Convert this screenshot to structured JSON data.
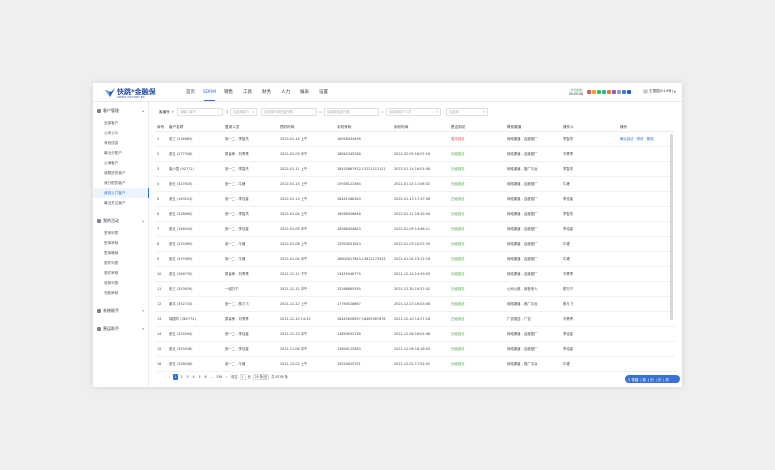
{
  "app": {
    "logo_text": "快跳*金融保",
    "logo_sub": "SDRM  VICTORY EX"
  },
  "nav": [
    {
      "label": "首页"
    },
    {
      "label": "SDRM"
    },
    {
      "label": "销售"
    },
    {
      "label": "工具"
    },
    {
      "label": "财务"
    },
    {
      "label": "人力"
    },
    {
      "label": "报表"
    },
    {
      "label": "设置"
    }
  ],
  "header": {
    "time_label": "今日在线",
    "time_value": "00:00:08",
    "user_name": "王振国(010号)"
  },
  "colors": {
    "accent": "#2a6fd6",
    "success": "#3aa23a",
    "danger": "#e04848"
  },
  "tools": [
    {
      "icon": "red-square-icon",
      "color": "#e35b4b"
    },
    {
      "icon": "orange-square-icon",
      "color": "#f0a030"
    },
    {
      "icon": "green-square-icon",
      "color": "#49b553"
    },
    {
      "icon": "teal-square-icon",
      "color": "#2fb7a6"
    },
    {
      "icon": "orange-square-icon",
      "color": "#f07a2a"
    },
    {
      "icon": "purple-square-icon",
      "color": "#8a5bd6"
    },
    {
      "icon": "grey-square-icon",
      "color": "#9aa3ad"
    },
    {
      "icon": "blue-square-icon",
      "color": "#3b7fe0"
    },
    {
      "icon": "blue-square-icon",
      "color": "#1f5fc8"
    }
  ],
  "sidebar": {
    "groups": [
      {
        "label": "客户管理",
        "icon": "users-icon",
        "items": [
          "全部客户",
          "公司公众",
          "有效信息",
          "最近分配户",
          "公海客户",
          "我跟进的客户",
          "我分配的客户",
          "我到上门客户",
          "最近关注客户"
        ]
      },
      {
        "label": "我的活动",
        "icon": "activity-icon",
        "items": [
          "签单列表",
          "签单审核",
          "签单撤销",
          "退件列表",
          "退件审核",
          "收款列表",
          "完款审核"
        ]
      },
      {
        "label": "系统助手",
        "icon": "helper-icon",
        "items": []
      },
      {
        "label": "营运助手",
        "icon": "ops-icon",
        "items": []
      }
    ],
    "active_item": "我到上门客户"
  },
  "filter": {
    "label": "客编号",
    "customer_placeholder": "请输入客户",
    "search_placeholder": "请选择部门",
    "time_from_placeholder": "请选择时间开始日期",
    "time_to_placeholder": "请选择结束日期",
    "dept_placeholder": "请选择部门人员",
    "status_placeholder": "请选择"
  },
  "table": {
    "headers": [
      "序号",
      "客户名称",
      "登录人员",
      "预约时间",
      "手机号码",
      "到访时间",
      "是否到访",
      "联系渠道",
      "操作人",
      "操作"
    ],
    "rows": [
      [
        "1",
        "张三 (234685)",
        "张一二 - 李智杰",
        "2022-01-14 上午",
        "18948434498",
        "",
        "暂未到访",
        "网络渠道 - 百度推广",
        "李智杰",
        "确认到访 · 修改 · 删除"
      ],
      [
        "2",
        "张五 (277336)",
        "蔡喜荣 - 刘青青",
        "2022-02-09 中午",
        "18642345288",
        "2022-02-09 16:07:16",
        "已经到访",
        "网络渠道 - 百度推广",
        "刘青青",
        ""
      ],
      [
        "3",
        "康小童 (92771)",
        "张一二 - 李智杰",
        "2022-01-11 上午",
        "18425867932,13121112121",
        "2022-01-14 16:01:08",
        "已经到访",
        "网络渠道 - 推广平台",
        "李智杰",
        ""
      ],
      [
        "4",
        "张五 (327635)",
        "张一二 - 牛峰",
        "2022-01-15 上午",
        "15938121584",
        "2022-01-14 11:06:32",
        "已经到访",
        "网络渠道 - 百度推广",
        "牛峰",
        ""
      ],
      [
        "5",
        "张五 (149224)",
        "张一二 - 李佳星",
        "2022-01-13 上午",
        "18441588183",
        "2022-01-13 17:37:08",
        "已经到访",
        "网络渠道 - 百度推广",
        "李佳星",
        ""
      ],
      [
        "6",
        "张五 (328460)",
        "张一二 - 李智杰",
        "2022-01-04 上午",
        "18568458648",
        "2022-01-11 16:33:44",
        "已经到访",
        "网络渠道 - 百度推广",
        "李智杰",
        ""
      ],
      [
        "7",
        "张五 (148044)",
        "张一二 - 李佳星",
        "2022-01-09 中午",
        "18568454643",
        "2022-01-09 14:46:11",
        "已经到访",
        "网络渠道 - 百度推广",
        "李佳星",
        ""
      ],
      [
        "8",
        "张五 (319365)",
        "张一二 - 牛峰",
        "2022-01-06 上午",
        "13953631643",
        "2022-01-03 10:07:34",
        "已经到访",
        "网络渠道 - 百度推广",
        "牛峰",
        ""
      ],
      [
        "9",
        "张五 (319365)",
        "张一二 - 牛峰",
        "2022-01-04 中午",
        "18602617640,13812173333",
        "2022-01-04 15:11:16",
        "已经到访",
        "网络渠道 - 百度推广",
        "牛峰",
        ""
      ],
      [
        "10",
        "张五 (346735)",
        "蔡喜荣 - 刘青青",
        "2021-12-11 下午",
        "13455546775",
        "2021-12-24 14:59:03",
        "已经到访",
        "网络渠道 - 百度推广",
        "刘青青",
        ""
      ],
      [
        "11",
        "张三 (353639)",
        "一组万宁",
        "2021-12-31 中午",
        "15268685395",
        "2021-12-30 10:37:42",
        "已经到访",
        "公司公推 - 销售来人",
        "蔡万宁",
        ""
      ],
      [
        "12",
        "谢平 (352733)",
        "张一二 - 蔡凡飞",
        "2021-12-22 上午",
        "17764528667",
        "2021-12-23 16:03:08",
        "已经到访",
        "网络渠道 - 推广平台",
        "蔡凡飞",
        ""
      ],
      [
        "13",
        "胡国华 (362774)",
        "蔡喜荣 - 刘青青",
        "2021-12-10 14:25",
        "18445628957,18463587878",
        "2021-12-10 14:27:16",
        "已经到访",
        "广告推送 - 广告",
        "刘青青",
        ""
      ],
      [
        "14",
        "张五 (325944)",
        "张一二 - 李佳星",
        "2021-12-13 中午",
        "13854632136",
        "2021-12-06 16:01:48",
        "已经到访",
        "网络渠道 - 百度推广",
        "李佳星",
        ""
      ],
      [
        "15",
        "张五 (353436)",
        "张一二 - 李佳星",
        "2021-11-06 中午",
        "13894125363",
        "2021-12-06 16:18:03",
        "已经到访",
        "网络渠道 - 百度推广",
        "李佳星",
        ""
      ],
      [
        "16",
        "张五 (328046)",
        "张一二 - 牛峰",
        "2021-12-02 上午",
        "15554615701",
        "2021-12-02 17:52:02",
        "已经到访",
        "网络渠道 - 推广平台",
        "牛峰",
        ""
      ]
    ]
  },
  "pager": {
    "pages": [
      "1",
      "2",
      "3",
      "4",
      "5",
      "6",
      "...",
      "338"
    ],
    "prev": "‹",
    "next": "›",
    "goto_label": "前往",
    "goto_value": "1",
    "goto_unit": "页",
    "size_label": "20 条/页",
    "total_label": "共 6736 条"
  },
  "float_bar": {
    "items": [
      "⚲ 快捷",
      "| 新",
      "| 旧",
      "| 记",
      "| 改"
    ]
  }
}
